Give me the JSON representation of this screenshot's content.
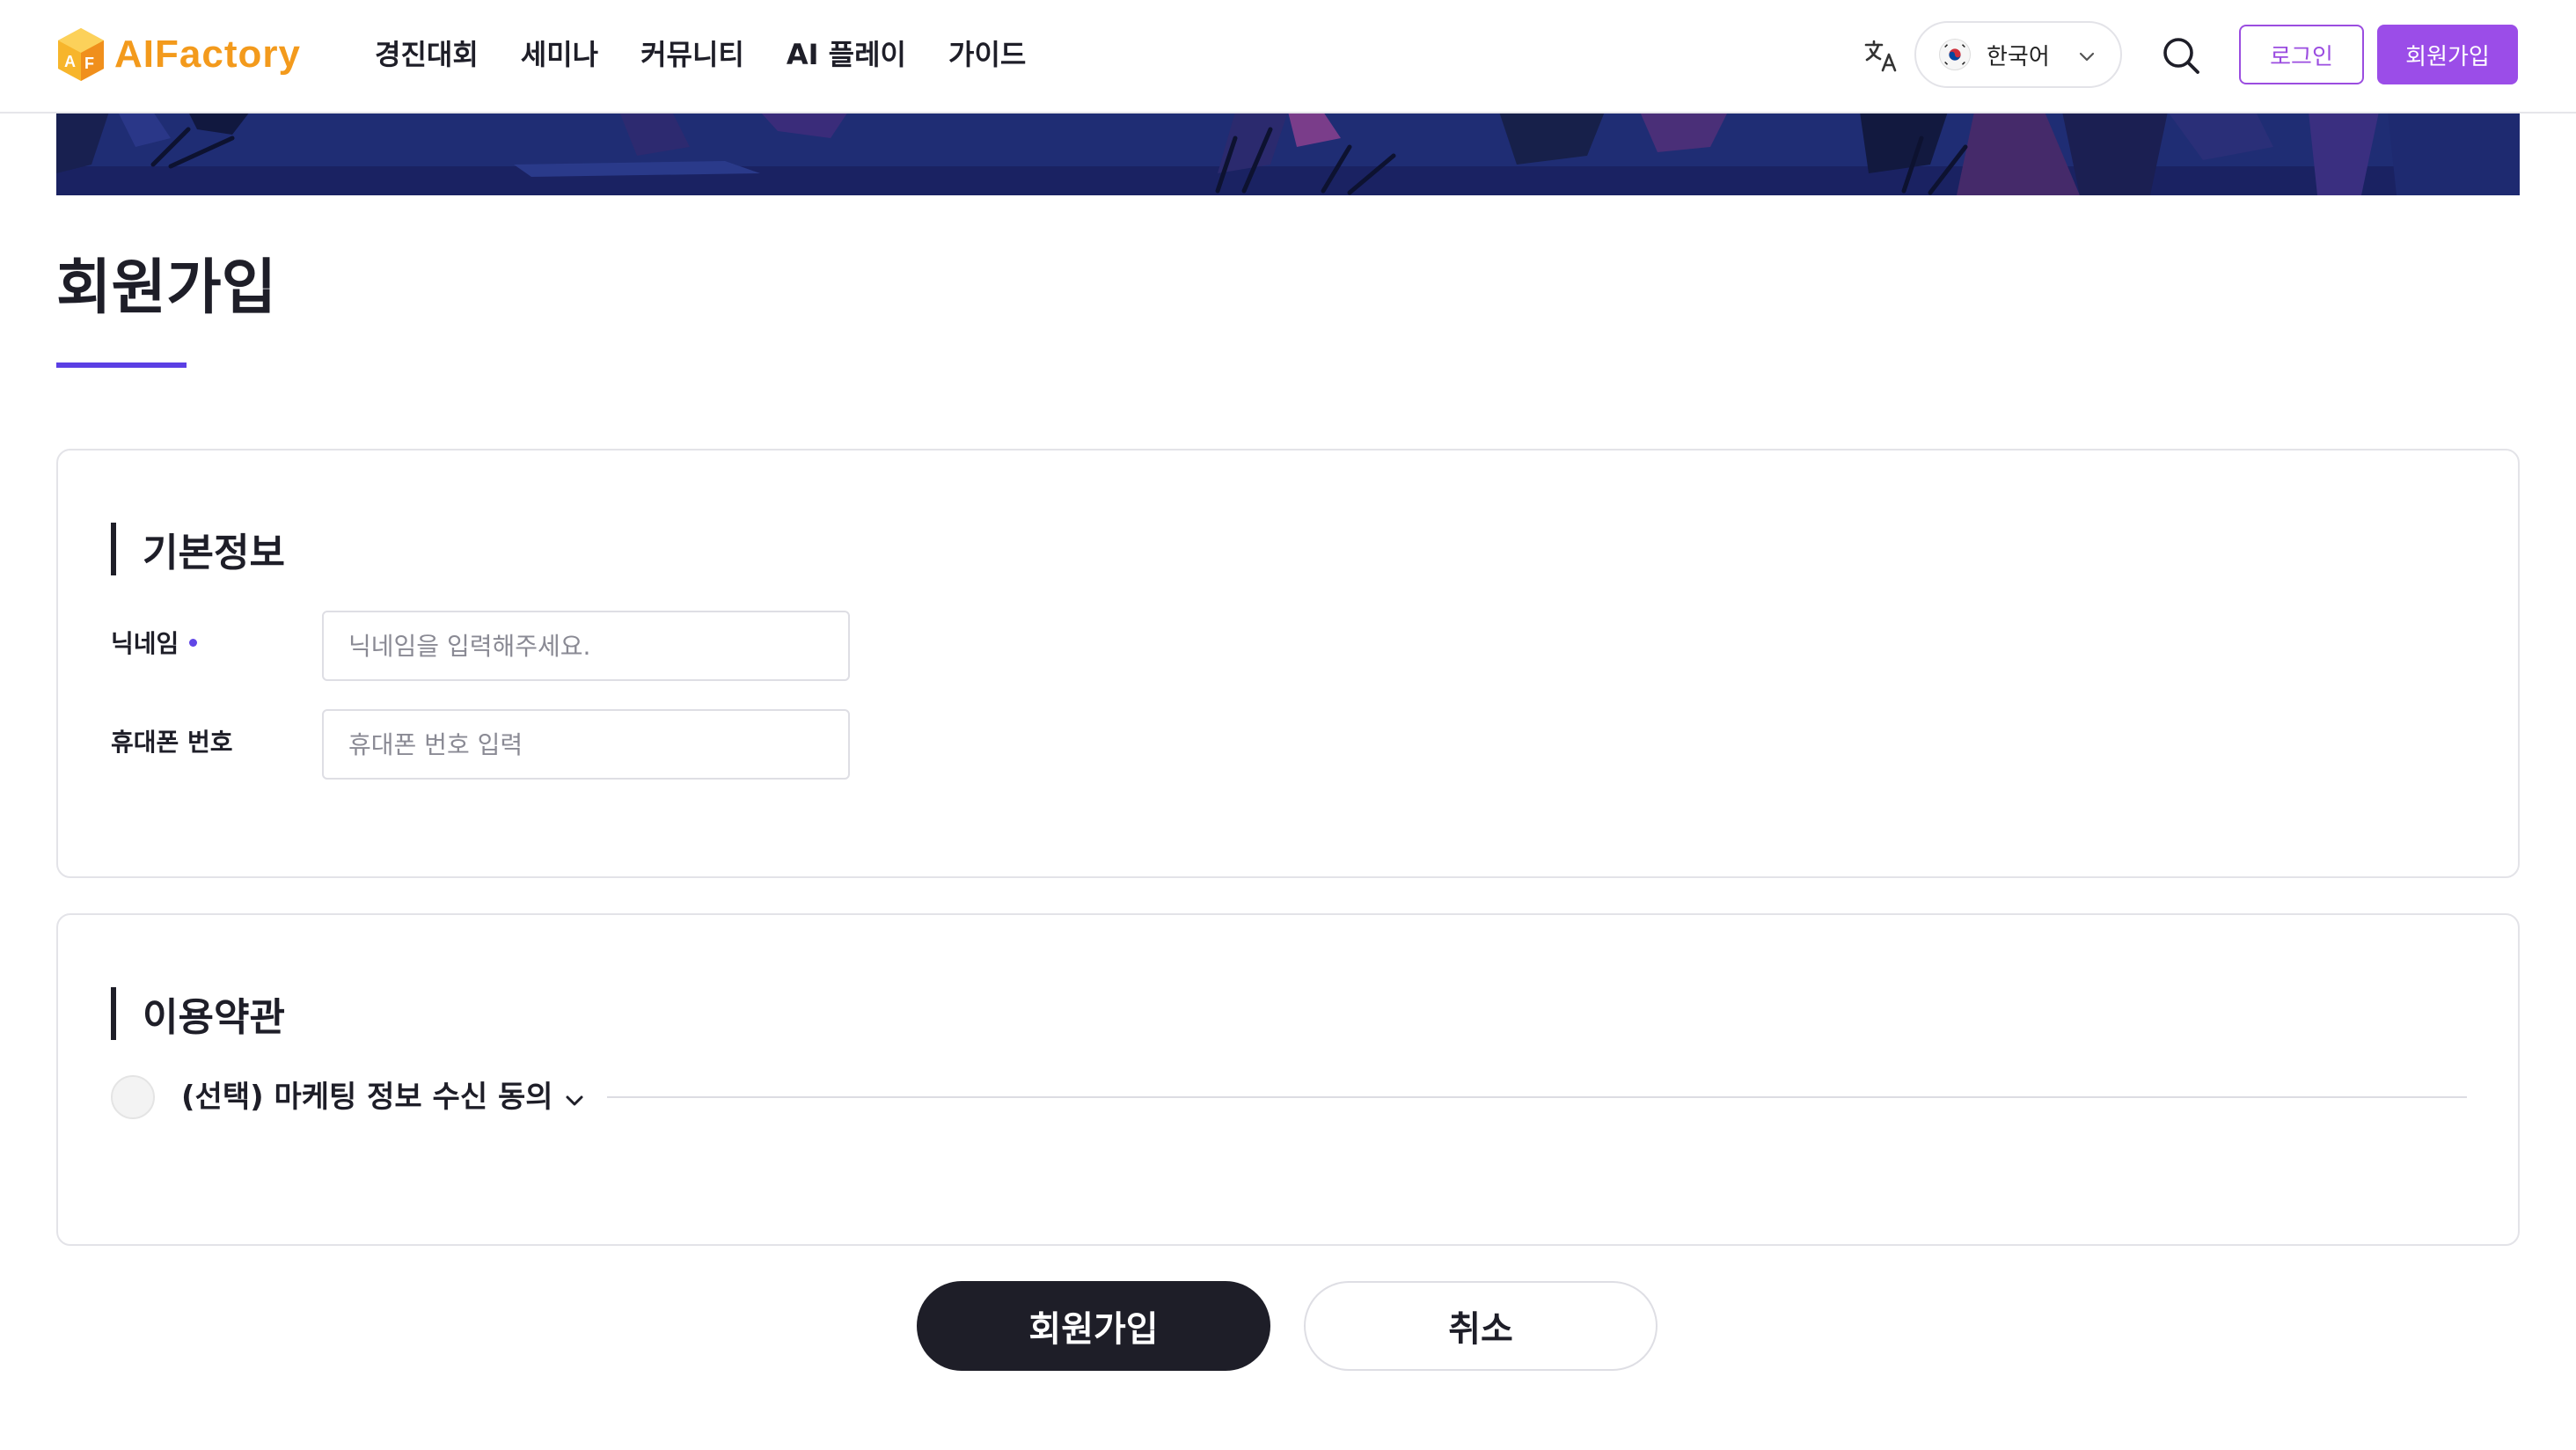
{
  "header": {
    "logo_text": "AIFactory",
    "nav": [
      "경진대회",
      "세미나",
      "커뮤니티",
      "AI 플레이",
      "가이드"
    ],
    "language": {
      "label": "한국어",
      "icon": "korea-flag-icon"
    },
    "login_label": "로그인",
    "signup_label": "회원가입"
  },
  "page": {
    "title": "회원가입"
  },
  "basic_info": {
    "title": "기본정보",
    "nickname": {
      "label": "닉네임",
      "placeholder": "닉네임을 입력해주세요.",
      "value": ""
    },
    "phone": {
      "label": "휴대폰 번호",
      "placeholder": "휴대폰 번호 입력",
      "value": ""
    }
  },
  "terms": {
    "title": "이용약관",
    "items": [
      {
        "label": "(선택) 마케팅 정보 수신 동의",
        "checked": false
      }
    ]
  },
  "actions": {
    "submit_label": "회원가입",
    "cancel_label": "취소"
  },
  "colors": {
    "accent": "#9b4de8",
    "title_underline": "#5b3fe4",
    "dark_button": "#1e1e28",
    "logo": "#f39a1c"
  }
}
